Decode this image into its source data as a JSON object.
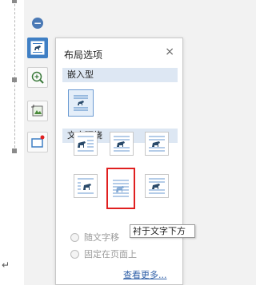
{
  "panel": {
    "title": "布局选项",
    "inline_section": "嵌入型",
    "wrap_section": "文字环绕",
    "radio_move_with_text": "随文字移",
    "radio_fix_on_page": "固定在页面上",
    "see_more": "查看更多...",
    "tooltip": "衬于文字下方"
  },
  "document": {
    "paragraph_mark": "↵"
  },
  "icons": {
    "minus": "−",
    "close": "×"
  },
  "colors": {
    "accent": "#3f7fc4",
    "section_bg": "#dde7f3",
    "highlight_red": "#e02020",
    "link": "#2f5fa7"
  }
}
